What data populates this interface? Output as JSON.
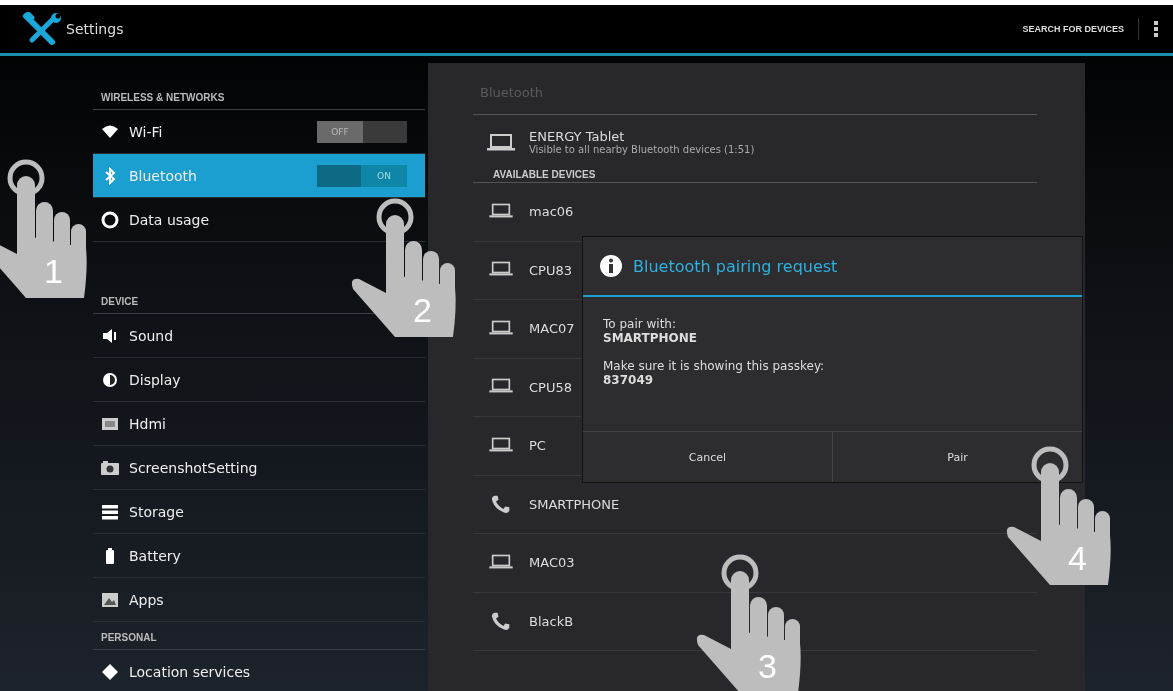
{
  "app_bar": {
    "title": "Settings",
    "action": "SEARCH FOR DEVICES"
  },
  "sidebar": {
    "sections": [
      {
        "header": "WIRELESS & NETWORKS",
        "items": [
          {
            "kind": "item",
            "label": "Wi-Fi",
            "selected": false,
            "toggle": {
              "on": false,
              "label": "OFF"
            }
          },
          {
            "kind": "item",
            "label": "Bluetooth",
            "selected": true,
            "toggle": {
              "on": true,
              "label": "ON"
            }
          },
          {
            "kind": "item",
            "label": "Data usage",
            "selected": false
          },
          {
            "kind": "covered"
          }
        ]
      },
      {
        "header": "DEVICE",
        "items": [
          {
            "kind": "item",
            "label": "Sound",
            "selected": false
          },
          {
            "kind": "item",
            "label": "Display",
            "selected": false
          },
          {
            "kind": "item",
            "label": "Hdmi",
            "selected": false
          },
          {
            "kind": "item",
            "label": "ScreenshotSetting",
            "selected": false
          },
          {
            "kind": "item",
            "label": "Storage",
            "selected": false
          },
          {
            "kind": "item",
            "label": "Battery",
            "selected": false
          },
          {
            "kind": "item",
            "label": "Apps",
            "selected": false
          }
        ]
      },
      {
        "header": "PERSONAL",
        "items": [
          {
            "kind": "item",
            "label": "Location services",
            "selected": false
          }
        ]
      }
    ]
  },
  "panel": {
    "title": "Bluetooth",
    "own_device": {
      "name": "ENERGY Tablet",
      "subtitle": "Visible to all nearby Bluetooth devices (1:51)"
    },
    "section_header": "AVAILABLE DEVICES",
    "devices": [
      {
        "name": "mac06",
        "kind": "computer"
      },
      {
        "name": "CPU83",
        "kind": "computer"
      },
      {
        "name": "MAC07",
        "kind": "computer"
      },
      {
        "name": "CPU58",
        "kind": "computer"
      },
      {
        "name": "PC",
        "kind": "computer"
      },
      {
        "name": "SMARTPHONE",
        "kind": "phone"
      },
      {
        "name": "MAC03",
        "kind": "computer"
      },
      {
        "name": "BlackB",
        "kind": "phone"
      }
    ]
  },
  "dialog": {
    "title": "Bluetooth pairing request",
    "lines": [
      {
        "text": "To pair with:",
        "bold": false
      },
      {
        "text": "SMARTPHONE",
        "bold": true
      },
      {
        "text": "Make sure it is showing this passkey:",
        "bold": false
      },
      {
        "text": "837049",
        "bold": true
      }
    ],
    "buttons": [
      "Cancel",
      "Pair"
    ]
  },
  "hands": [
    {
      "label": "1"
    },
    {
      "label": "2"
    },
    {
      "label": "3"
    },
    {
      "label": "4"
    }
  ]
}
